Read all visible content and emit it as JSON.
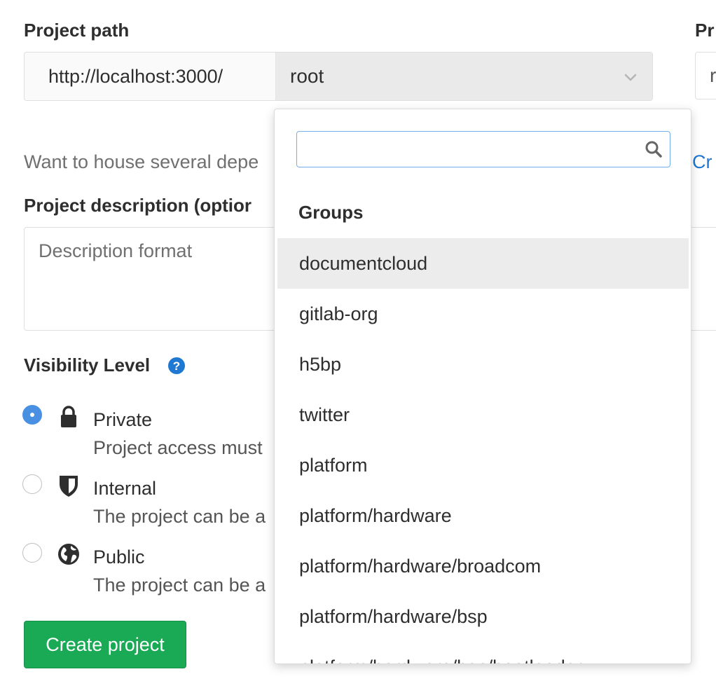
{
  "form": {
    "project_path_label": "Project path",
    "project_path_prefix": "http://localhost:3000/",
    "namespace_value": "root",
    "project_name_label_partial": "Pr",
    "project_name_value_partial": "r",
    "group_hint_partial": "Want to house several depe",
    "create_group_link_partial": "Cr",
    "description_label_partial": "Project description (optior",
    "description_placeholder": "Description format",
    "visibility_label": "Visibility Level",
    "visibility_options": [
      {
        "title": "Private",
        "description_partial": "Project access must",
        "checked": true,
        "icon": "lock-icon"
      },
      {
        "title": "Internal",
        "description_partial": "The project can be a",
        "checked": false,
        "icon": "shield-icon"
      },
      {
        "title": "Public",
        "description_partial": "The project can be a",
        "checked": false,
        "icon": "globe-icon"
      }
    ],
    "create_button_label": "Create project"
  },
  "dropdown": {
    "search_value": "",
    "header": "Groups",
    "items": [
      {
        "label": "documentcloud",
        "highlighted": true
      },
      {
        "label": "gitlab-org",
        "highlighted": false
      },
      {
        "label": "h5bp",
        "highlighted": false
      },
      {
        "label": "twitter",
        "highlighted": false
      },
      {
        "label": "platform",
        "highlighted": false
      },
      {
        "label": "platform/hardware",
        "highlighted": false
      },
      {
        "label": "platform/hardware/broadcom",
        "highlighted": false
      },
      {
        "label": "platform/hardware/bsp",
        "highlighted": false
      },
      {
        "label": "platform/hardware/bsp/bootloader",
        "highlighted": false
      }
    ]
  },
  "colors": {
    "accent_blue": "#1f78d1",
    "radio_checked": "#4a90e2",
    "create_button": "#1aaa55",
    "highlight_row": "#ececec"
  }
}
